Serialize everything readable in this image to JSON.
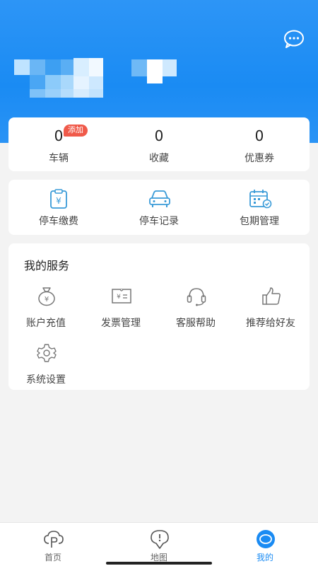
{
  "stats": [
    {
      "value": "0",
      "label": "车辆",
      "badge": "添加"
    },
    {
      "value": "0",
      "label": "收藏"
    },
    {
      "value": "0",
      "label": "优惠券"
    }
  ],
  "quick_actions": [
    {
      "label": "停车缴费",
      "icon": "parking-fee-icon"
    },
    {
      "label": "停车记录",
      "icon": "car-icon"
    },
    {
      "label": "包期管理",
      "icon": "calendar-icon"
    }
  ],
  "services": {
    "title": "我的服务",
    "items": [
      {
        "label": "账户充值",
        "icon": "money-bag-icon"
      },
      {
        "label": "发票管理",
        "icon": "invoice-icon"
      },
      {
        "label": "客服帮助",
        "icon": "headset-icon"
      },
      {
        "label": "推荐给好友",
        "icon": "thumbs-up-icon"
      },
      {
        "label": "系统设置",
        "icon": "gear-icon"
      }
    ]
  },
  "tabbar": [
    {
      "label": "首页",
      "icon": "cloud-p-icon",
      "active": false
    },
    {
      "label": "地图",
      "icon": "map-pin-icon",
      "active": false
    },
    {
      "label": "我的",
      "icon": "profile-icon",
      "active": true
    }
  ],
  "colors": {
    "primary": "#1a8bf3",
    "badge": "#f05a4a",
    "icon_blue": "#3a9bd8"
  }
}
